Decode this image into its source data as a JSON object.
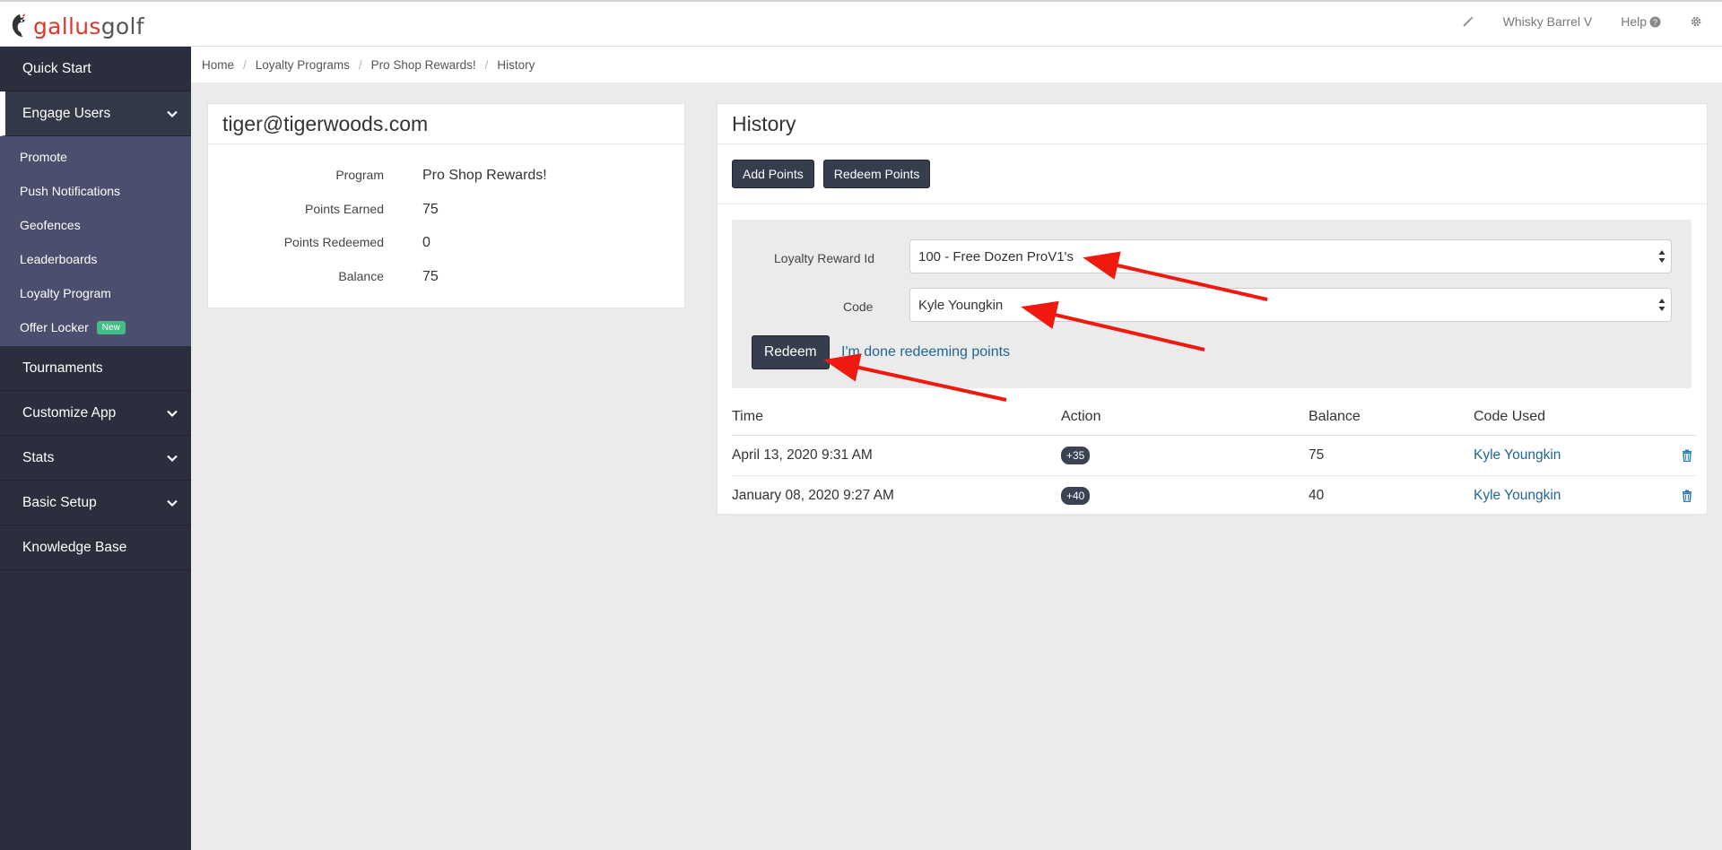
{
  "app": {
    "logo_part1": "gallus",
    "logo_part2": "golf"
  },
  "topbar": {
    "course_name": "Whisky Barrel V",
    "help_label": "Help",
    "icons": [
      "magic-wand-icon",
      "question-circle-icon",
      "gear-icon"
    ]
  },
  "sidebar": {
    "quick_start": "Quick Start",
    "engage_users": "Engage Users",
    "engage_sub": {
      "promote": "Promote",
      "push_notifications": "Push Notifications",
      "geofences": "Geofences",
      "leaderboards": "Leaderboards",
      "loyalty_program": "Loyalty Program",
      "offer_locker": "Offer Locker",
      "offer_locker_badge": "New"
    },
    "tournaments": "Tournaments",
    "customize_app": "Customize App",
    "stats": "Stats",
    "basic_setup": "Basic Setup",
    "knowledge_base": "Knowledge Base"
  },
  "breadcrumb": {
    "home": "Home",
    "loyalty_programs": "Loyalty Programs",
    "program": "Pro Shop Rewards!",
    "current": "History"
  },
  "user_panel": {
    "email": "tiger@tigerwoods.com",
    "program_label": "Program",
    "program_value": "Pro Shop Rewards!",
    "earned_label": "Points Earned",
    "earned_value": "75",
    "redeemed_label": "Points Redeemed",
    "redeemed_value": "0",
    "balance_label": "Balance",
    "balance_value": "75"
  },
  "history_panel": {
    "title": "History",
    "add_points": "Add Points",
    "redeem_points": "Redeem Points",
    "form": {
      "reward_label": "Loyalty Reward Id",
      "reward_value": "100 - Free Dozen ProV1's",
      "code_label": "Code",
      "code_value": "Kyle Youngkin",
      "redeem_button": "Redeem",
      "done_link": "I'm done redeeming points"
    },
    "table": {
      "headers": {
        "time": "Time",
        "action": "Action",
        "balance": "Balance",
        "code_used": "Code Used"
      },
      "rows": [
        {
          "time": "April 13, 2020 9:31 AM",
          "action": "+35",
          "balance": "75",
          "code_used": "Kyle Youngkin"
        },
        {
          "time": "January 08, 2020 9:27 AM",
          "action": "+40",
          "balance": "40",
          "code_used": "Kyle Youngkin"
        }
      ]
    }
  },
  "colors": {
    "sidebar_bg": "#2b2f3d",
    "subnav_bg": "#4b4e6c",
    "button_dark": "#363d4c",
    "link_blue": "#1f6598",
    "logo_red": "#d8392b",
    "badge_green": "#46bb8a",
    "annotation_red": "#f0190f"
  }
}
